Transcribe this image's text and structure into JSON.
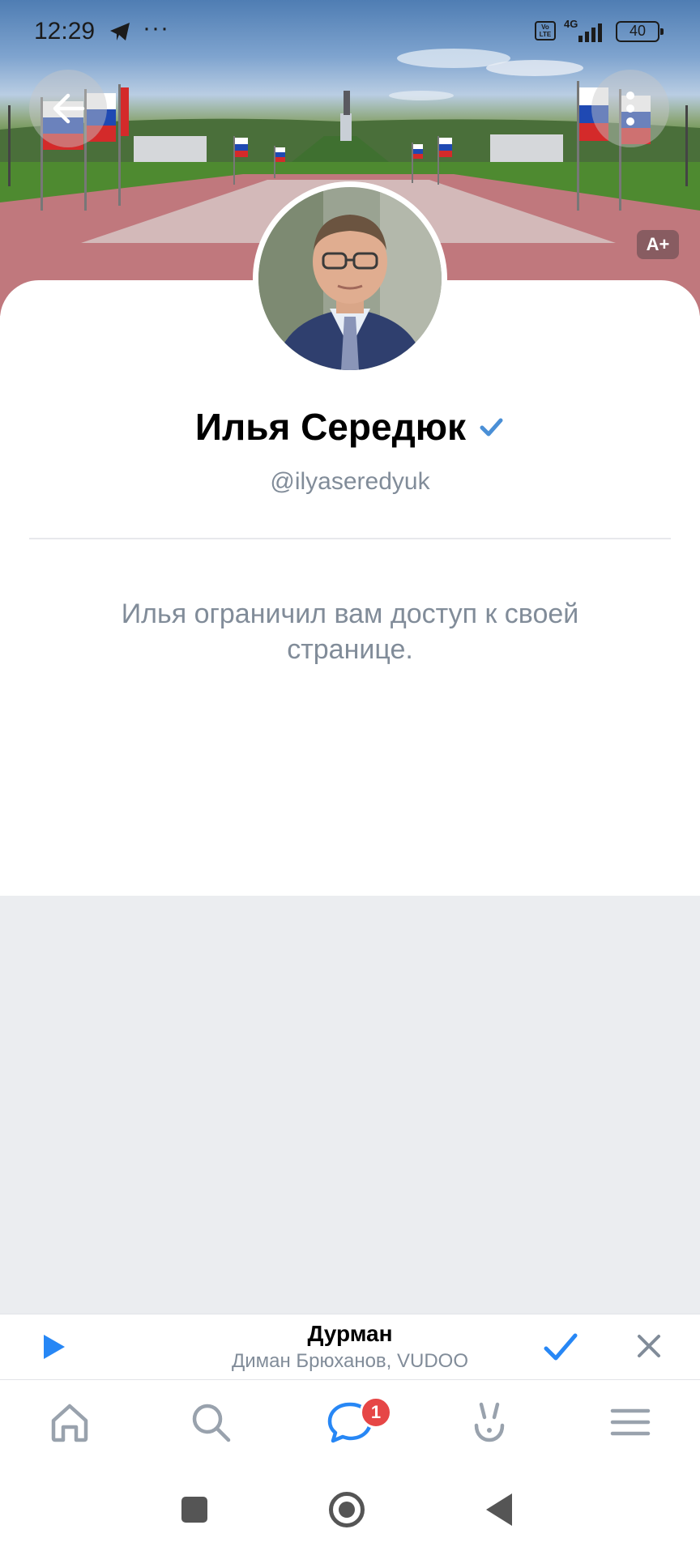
{
  "status_bar": {
    "time": "12:29",
    "overflow": "···",
    "volte": "Vo LTE",
    "network": "4G",
    "battery": "40"
  },
  "header": {
    "back_icon": "arrow-left-icon",
    "more_icon": "more-vertical-icon",
    "font_size_badge": "A+"
  },
  "profile": {
    "name": "Илья Середюк",
    "verified": true,
    "username": "@ilyaseredyuk",
    "restricted_message": "Илья ограничил вам доступ к своей странице."
  },
  "player": {
    "track_title": "Дурман",
    "track_artist": "Диман Брюханов, VUDOO",
    "play_icon": "play-icon",
    "added_icon": "check-icon",
    "close_icon": "close-icon"
  },
  "tabbar": {
    "items": [
      {
        "name": "home",
        "icon": "home-icon"
      },
      {
        "name": "search",
        "icon": "search-icon"
      },
      {
        "name": "messages",
        "icon": "chat-bubble-icon",
        "badge": "1"
      },
      {
        "name": "clips",
        "icon": "clips-icon"
      },
      {
        "name": "menu",
        "icon": "menu-icon"
      }
    ]
  },
  "colors": {
    "accent": "#2787f5",
    "text_secondary": "#818c99",
    "badge": "#e64646",
    "page_background": "#ebedf0"
  }
}
